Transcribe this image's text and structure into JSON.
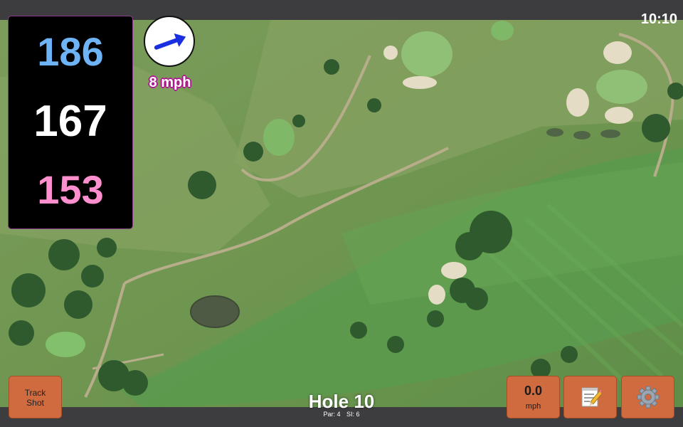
{
  "status_bar": {
    "time": "10:10"
  },
  "distances": {
    "back": "186",
    "middle": "167",
    "front": "153",
    "colors": {
      "back": "#6db3f5",
      "middle": "#ffffff",
      "front": "#ff8fcf"
    }
  },
  "wind": {
    "speed_label": "8 mph",
    "direction_icon": "arrow-icon"
  },
  "hole": {
    "title": "Hole 10",
    "par": "Par: 4",
    "stroke_index": "SI: 6"
  },
  "buttons": {
    "track_shot": "Track\nShot",
    "wind_speed_value": "0.0",
    "wind_speed_unit": "mph",
    "scorecard_icon": "memo-icon",
    "settings_icon": "gear-icon",
    "color": "#d06b3f"
  },
  "map": {
    "type": "satellite aerial view of golf course"
  }
}
